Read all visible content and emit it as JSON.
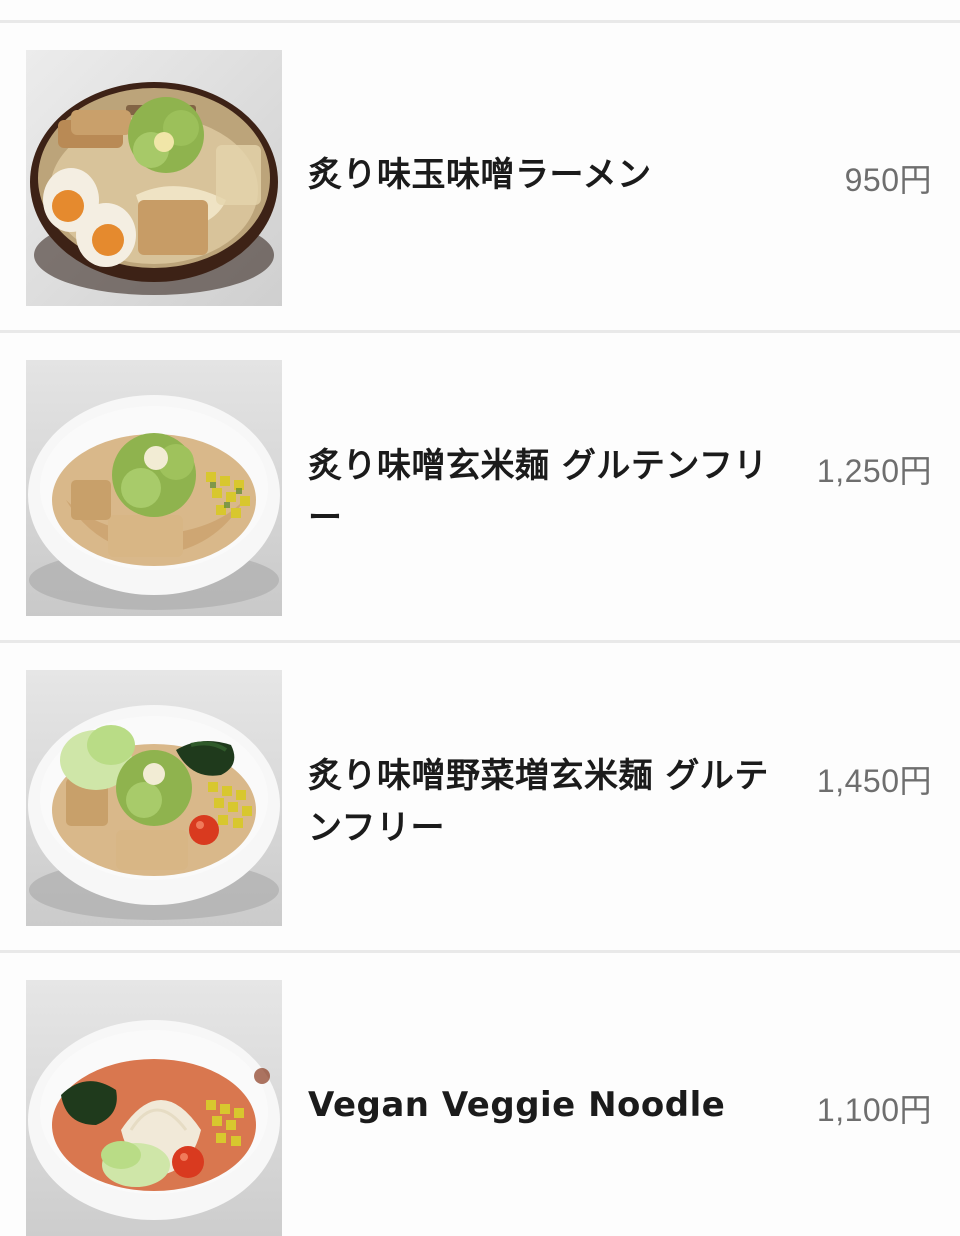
{
  "menu": {
    "items": [
      {
        "name": "炙り味玉味噌ラーメン",
        "price": "950円",
        "image": "miso-ramen-egg-photo"
      },
      {
        "name": "炙り味噌玄米麺 グルテンフリー",
        "price": "1,250円",
        "image": "miso-brown-rice-noodle-photo"
      },
      {
        "name": "炙り味噌野菜増玄米麺 グルテンフリー",
        "price": "1,450円",
        "image": "miso-veggie-brown-rice-noodle-photo"
      },
      {
        "name": "Vegan Veggie Noodle",
        "price": "1,100円",
        "image": "vegan-veggie-noodle-photo"
      }
    ]
  },
  "colors": {
    "divider": "#e9e9e9",
    "name_text": "#1b1b1b",
    "price_text": "#6e6e6e",
    "background": "#fdfdfd"
  }
}
